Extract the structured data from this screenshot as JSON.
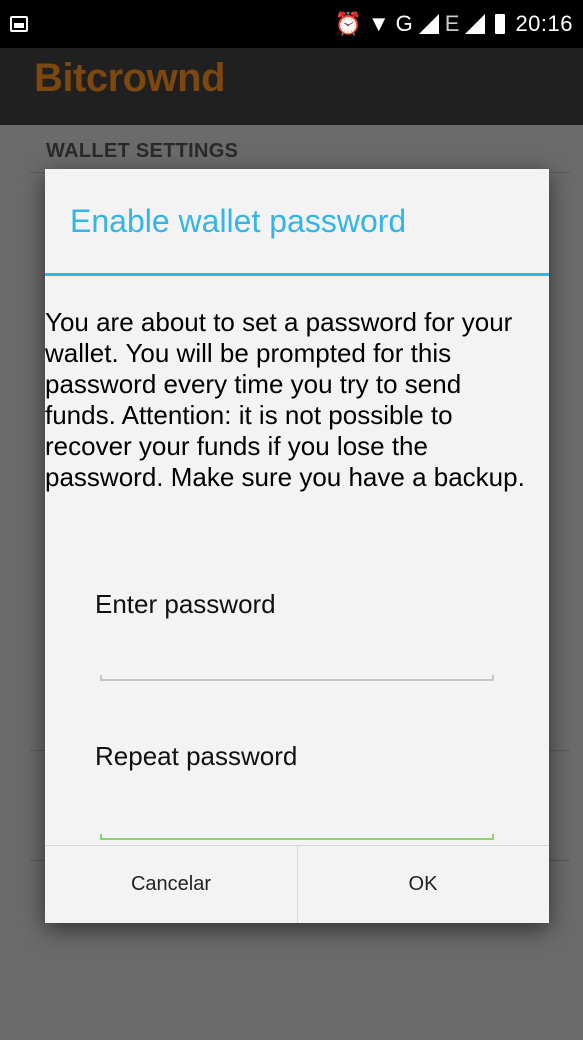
{
  "status_bar": {
    "time": "20:16",
    "icons": [
      "image-icon",
      "alarm-icon",
      "wifi-icon",
      "g-network-icon",
      "signal-icon",
      "e-network-icon",
      "signal-icon",
      "battery-icon"
    ],
    "network_g": "G",
    "network_e": "E"
  },
  "app": {
    "brand": "Bitcrownd",
    "brand_color": "#7d4710"
  },
  "background": {
    "section_title": "WALLET SETTINGS"
  },
  "dialog": {
    "title": "Enable wallet password",
    "message": "You are about to set a password for your wallet. You will be prompted for this password every time you try to send funds. Attention: it is not possible to recover your funds if you lose the password. Make sure you have a backup.",
    "fields": [
      {
        "label": "Enter password",
        "value": ""
      },
      {
        "label": "Repeat password",
        "value": ""
      }
    ],
    "buttons": {
      "cancel": "Cancelar",
      "ok": "OK"
    },
    "accent_color": "#33b5e5",
    "focus_color": "#8bd46b"
  }
}
